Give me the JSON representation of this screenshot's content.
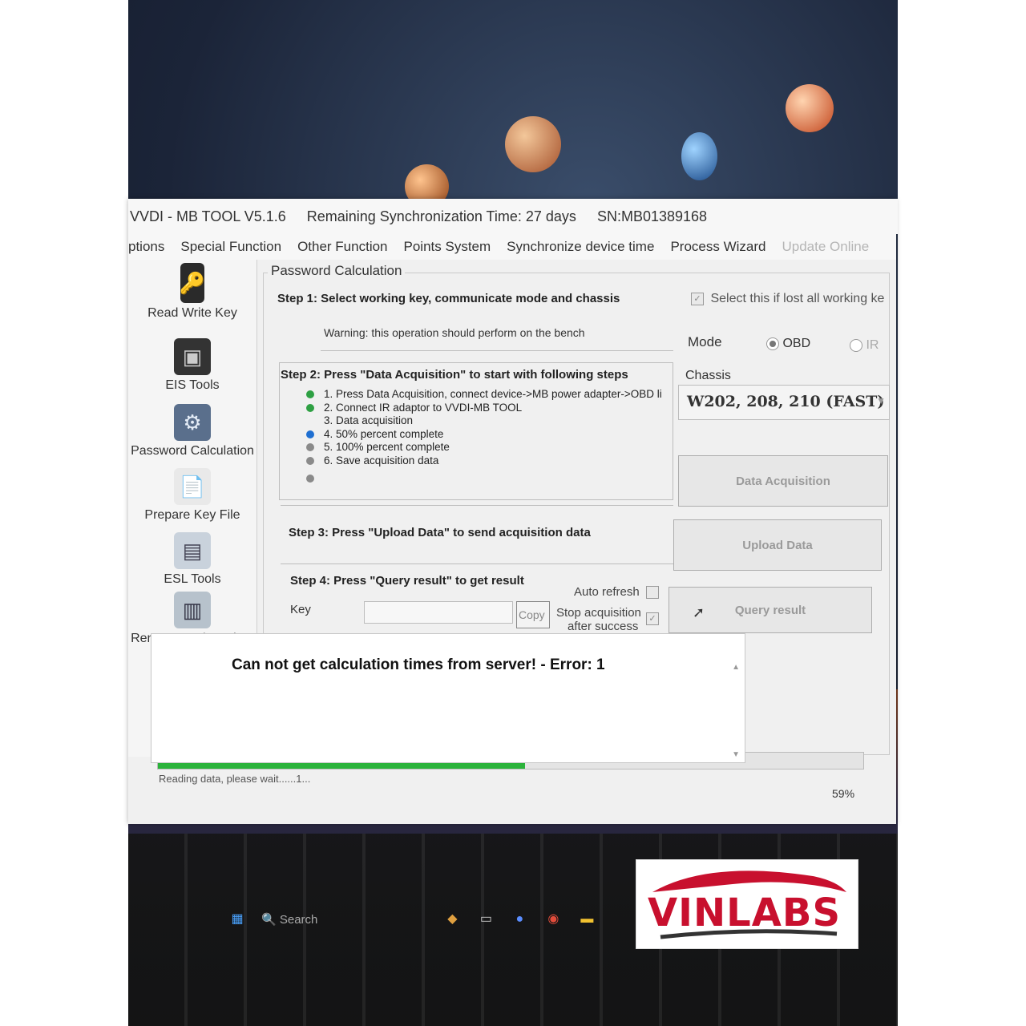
{
  "window": {
    "title": "VVDI - MB TOOL V5.1.6",
    "sync_time": "Remaining Synchronization Time: 27 days",
    "serial": "SN:MB01389168"
  },
  "menu": [
    {
      "label": "ptions"
    },
    {
      "label": "Special Function"
    },
    {
      "label": "Other Function"
    },
    {
      "label": "Points System"
    },
    {
      "label": "Synchronize device time"
    },
    {
      "label": "Process Wizard"
    },
    {
      "label": "Update Online"
    }
  ],
  "sidebar": {
    "items": [
      {
        "label": "Read Write Key"
      },
      {
        "label": "EIS Tools"
      },
      {
        "label": "Password Calculation"
      },
      {
        "label": "Prepare Key File"
      },
      {
        "label": "ESL Tools"
      },
      {
        "label": "Renew ECU/Gearbox"
      }
    ]
  },
  "panel": {
    "title": "Password Calculation",
    "step1": {
      "title": "Step 1: Select working key, communicate mode and chassis",
      "warning": "Warning: this operation should perform on the bench",
      "select_lost_label": "Select this if lost all working ke",
      "mode_label": "Mode",
      "mode_obd": "OBD",
      "mode_ir": "IR",
      "chassis_label": "Chassis",
      "chassis_value": "W202, 208, 210 (FAST)"
    },
    "step2": {
      "title": "Step 2: Press \"Data Acquisition\" to start with following steps",
      "items": [
        "1. Press Data Acquisition, connect device->MB power adapter->OBD li",
        "2. Connect IR adaptor to VVDI-MB TOOL",
        "3. Data acquisition",
        "4. 50%  percent complete",
        "5. 100% percent complete",
        "6. Save acquisition data"
      ],
      "button": "Data Acquisition"
    },
    "step3": {
      "title": "Step 3: Press \"Upload Data\" to send acquisition data",
      "button": "Upload Data"
    },
    "step4": {
      "title": "Step 4: Press \"Query result\" to get result",
      "key_label": "Key",
      "key_value": "",
      "copy_button": "Copy",
      "auto_refresh": "Auto refresh",
      "stop_acq_line1": "Stop acquisition",
      "stop_acq_line2": "after success",
      "button": "Query result"
    }
  },
  "log": {
    "message": "Can not get calculation times from server! - Error: 1"
  },
  "status": {
    "text": "Reading data, please wait......1...",
    "percent_label": "59%",
    "progress": 0.52
  },
  "taskbar": {
    "search": "Search"
  },
  "logo": {
    "text": "VINLABS"
  },
  "colors": {
    "progress": "#2bb33b",
    "dot_done": "#2ea043",
    "dot_active": "#1f6fd1",
    "dot_pending": "#8a8a8a",
    "logo_red": "#c8102e"
  }
}
